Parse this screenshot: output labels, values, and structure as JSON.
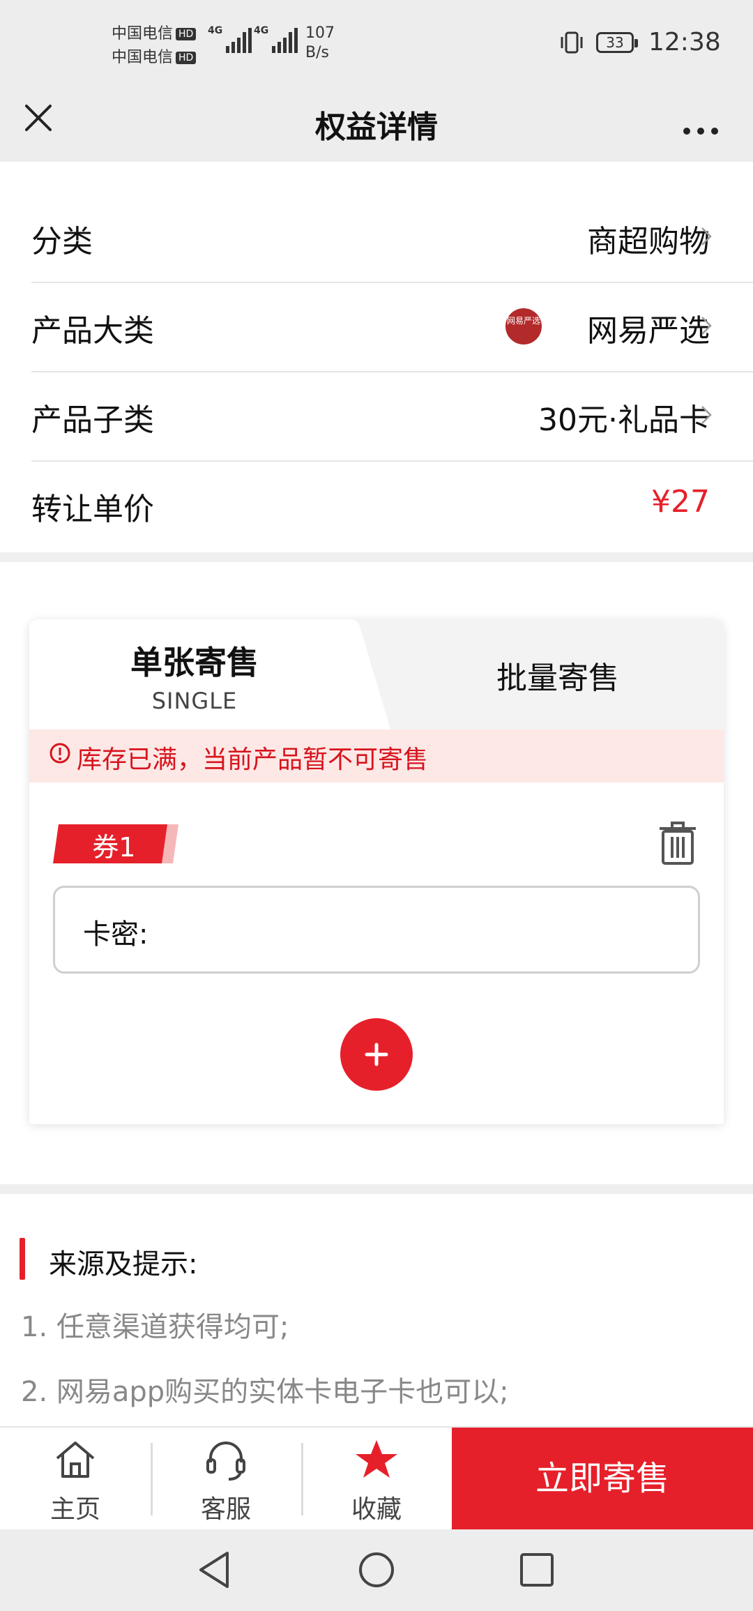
{
  "status_bar": {
    "carrier1": "中国电信",
    "carrier2": "中国电信",
    "hd": "HD",
    "net_type": "4G",
    "net_speed_value": "107",
    "net_speed_unit": "B/s",
    "battery": "33",
    "time": "12:38"
  },
  "header": {
    "title": "权益详情",
    "close_icon": "close-icon",
    "more_icon": "more-icon"
  },
  "info_rows": [
    {
      "label": "分类",
      "value": "商超购物"
    },
    {
      "label": "产品大类",
      "value": "网易严选",
      "logo_text": "网易严选"
    },
    {
      "label": "产品子类",
      "value": "30元·礼品卡"
    },
    {
      "label": "转让单价",
      "value": "¥27",
      "value_color": "#e6202a"
    }
  ],
  "tabs": {
    "single_label": "单张寄售",
    "single_sub": "SINGLE",
    "batch_label": "批量寄售"
  },
  "warning": {
    "text": "库存已满，当前产品暂不可寄售"
  },
  "voucher": {
    "label": "券1",
    "card_field_label": "卡密:"
  },
  "tips": {
    "title": "来源及提示:",
    "lines": [
      "1. 任意渠道获得均可;",
      "2. 网易app购买的实体卡电子卡也可以;"
    ]
  },
  "bottom_nav": {
    "items": [
      {
        "label": "主页",
        "icon": "home-icon"
      },
      {
        "label": "客服",
        "icon": "headset-icon"
      },
      {
        "label": "收藏",
        "icon": "star-icon"
      }
    ],
    "sell_button": "立即寄售"
  },
  "colors": {
    "accent": "#e6202a",
    "warning_bg": "#fde8e6"
  }
}
